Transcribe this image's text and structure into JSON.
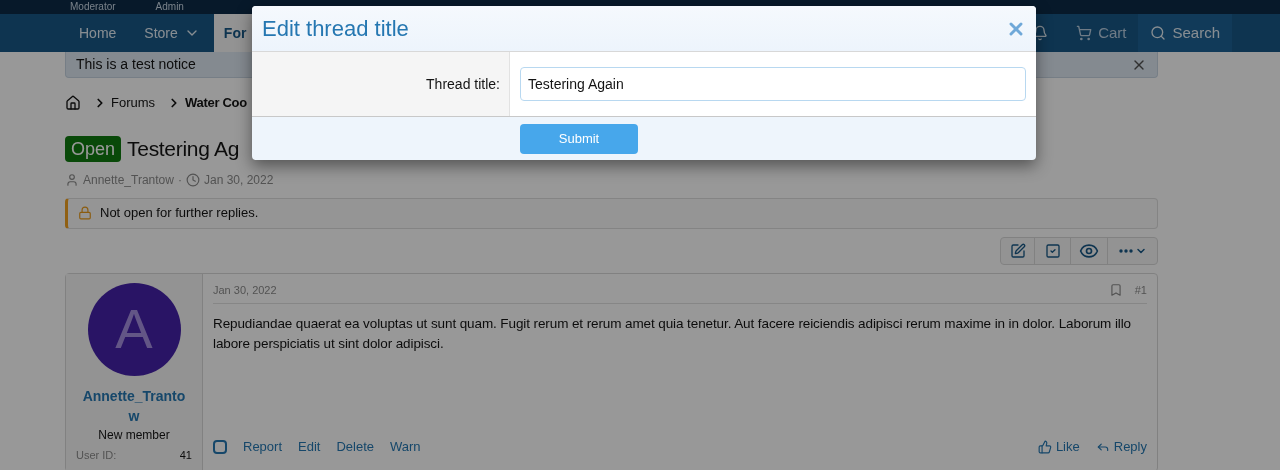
{
  "top_bar": {
    "items": [
      "Moderator",
      "Admin"
    ]
  },
  "nav": {
    "tabs": [
      {
        "label": "Home",
        "selected": false,
        "dropdown": false
      },
      {
        "label": "Store",
        "selected": false,
        "dropdown": true
      },
      {
        "label": "For",
        "selected": true,
        "dropdown": false
      }
    ],
    "right": [
      "Cart",
      "Search"
    ]
  },
  "notice": {
    "text": "This is a test notice"
  },
  "breadcrumbs": [
    {
      "label": "Forums",
      "bold": false
    },
    {
      "label": "Water Coo",
      "bold": true
    }
  ],
  "thread": {
    "prefix": "Open",
    "title": "Testering Ag",
    "author": "Annette_Trantow",
    "separator": "·",
    "date": "Jan 30, 2022"
  },
  "closed_notice": "Not open for further replies.",
  "post": {
    "username": "Annette_Trantow",
    "avatar_letter": "A",
    "role": "New member",
    "user_id_label": "User ID:",
    "user_id": "41",
    "date": "Jan 30, 2022",
    "number": "#1",
    "body": "Repudiandae quaerat ea voluptas ut sunt quam. Fugit rerum et rerum amet quia tenetur. Aut facere reiciendis adipisci rerum maxime in in dolor. Laborum illo labore perspiciatis ut sint dolor adipisci.",
    "selected": false,
    "actions": [
      "Report",
      "Edit",
      "Delete",
      "Warn"
    ],
    "reactions": [
      "Like",
      "Reply"
    ]
  },
  "dialog": {
    "title": "Edit thread title",
    "field_label": "Thread title:",
    "field_value": "Testering Again",
    "submit": "Submit"
  }
}
